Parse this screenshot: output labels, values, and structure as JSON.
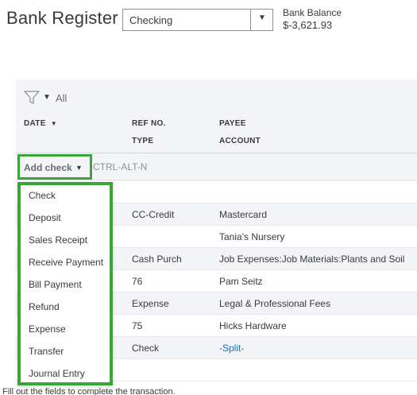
{
  "header": {
    "title": "Bank Register",
    "account": "Checking",
    "balance_label": "Bank Balance",
    "balance_value": "$-3,621.93"
  },
  "filter": {
    "label": "All"
  },
  "columns": {
    "date": "DATE",
    "ref_no": "REF NO.",
    "type": "TYPE",
    "payee": "PAYEE",
    "account": "ACCOUNT"
  },
  "add_button": {
    "label": "Add check",
    "shortcut": "CTRL-ALT-N"
  },
  "rows": [
    {
      "ref": "",
      "payee": ""
    },
    {
      "ref": "CC-Credit",
      "payee": "Mastercard"
    },
    {
      "ref": "",
      "payee": "Tania's Nursery"
    },
    {
      "ref": "Cash Purch",
      "payee": "Job Expenses:Job Materials:Plants and Soil"
    },
    {
      "ref": "76",
      "payee": "Pam Seitz"
    },
    {
      "ref": "Expense",
      "payee": "Legal & Professional Fees"
    },
    {
      "ref": "75",
      "payee": "Hicks Hardware"
    },
    {
      "ref": "Check",
      "payee": "-Split-"
    },
    {
      "ref": "",
      "payee": ""
    }
  ],
  "menu": [
    "Check",
    "Deposit",
    "Sales Receipt",
    "Receive Payment",
    "Bill Payment",
    "Refund",
    "Expense",
    "Transfer",
    "Journal Entry"
  ],
  "footer": "Fill out the fields to complete the transaction.",
  "colors": {
    "highlight": "#3aa638",
    "link": "#0077c5",
    "panel": "#f4f5f8"
  }
}
